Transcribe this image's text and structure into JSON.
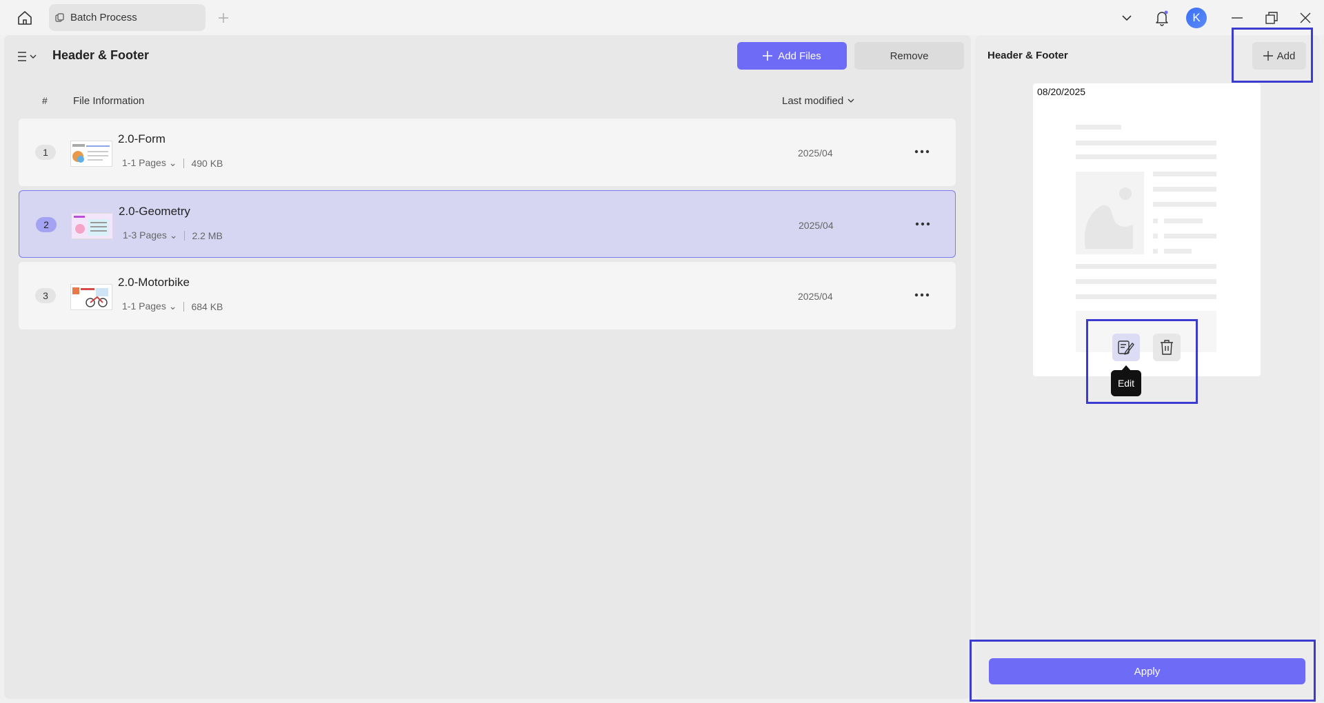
{
  "titlebar": {
    "tab_label": "Batch Process",
    "avatar_initial": "K",
    "icons": [
      "home-icon",
      "batch-icon",
      "plus-icon",
      "chevron-down-icon",
      "bell-icon",
      "minimize-icon",
      "restore-icon",
      "close-icon"
    ]
  },
  "left": {
    "title": "Header & Footer",
    "add_files_label": "Add Files",
    "remove_label": "Remove",
    "columns": {
      "hash": "#",
      "info": "File Information",
      "modified": "Last modified"
    },
    "files": [
      {
        "num": "1",
        "name": "2.0-Form",
        "pages": "1-1 Pages",
        "size": "490 KB",
        "date": "2025/04",
        "selected": false
      },
      {
        "num": "2",
        "name": "2.0-Geometry",
        "pages": "1-3 Pages",
        "size": "2.2 MB",
        "date": "2025/04",
        "selected": true
      },
      {
        "num": "3",
        "name": "2.0-Motorbike",
        "pages": "1-1 Pages",
        "size": "684 KB",
        "date": "2025/04",
        "selected": false
      }
    ]
  },
  "right": {
    "title": "Header & Footer",
    "add_label": "Add",
    "template_date": "08/20/2025",
    "tooltip": "Edit",
    "apply_label": "Apply"
  },
  "colors": {
    "accent": "#6e6cf7",
    "highlight": "#3b3bd0",
    "selected_row": "#d6d6f2"
  }
}
